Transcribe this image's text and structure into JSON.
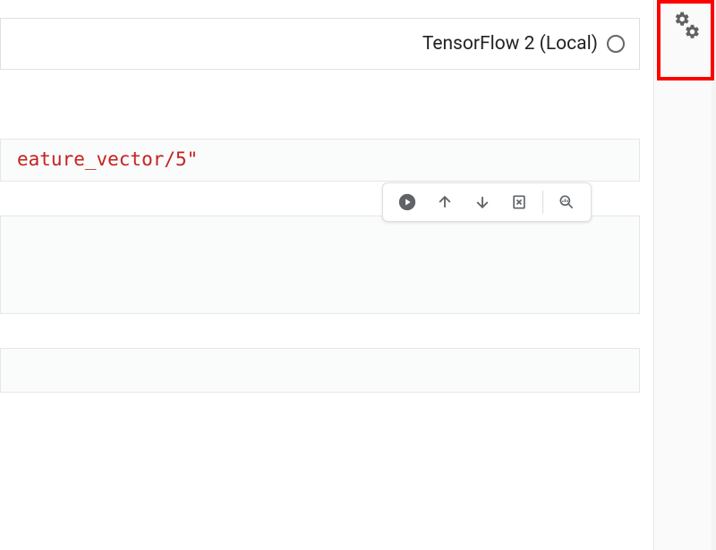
{
  "kernel": {
    "label": "TensorFlow 2 (Local)"
  },
  "cells": [
    {
      "content": "eature_vector/5\""
    },
    {
      "content": ""
    },
    {
      "content": ""
    }
  ],
  "toolbar": {
    "run": "Run",
    "move_up": "Move Up",
    "move_down": "Move Down",
    "clear": "Clear Output",
    "inspect": "Toggle Variable Inspector"
  },
  "icons": {
    "settings": "settings",
    "play": "play",
    "arrow_up": "arrow-up",
    "arrow_down": "arrow-down",
    "clear": "clear",
    "chart": "chart"
  },
  "colors": {
    "highlight": "#ff0000",
    "string": "#c5221f"
  }
}
